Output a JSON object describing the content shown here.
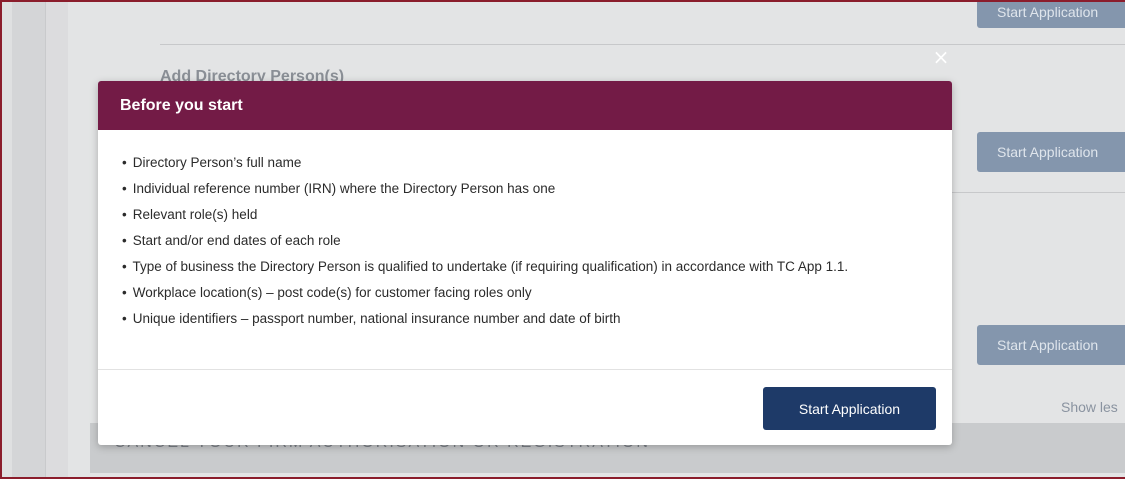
{
  "background": {
    "section_title": "Add Directory Person(s)",
    "start_button_label": "Start Application",
    "show_less": "Show les",
    "cancel_heading": "CANCEL YOUR FIRM AUTHORISATION OR REGISTRATION"
  },
  "modal": {
    "close_glyph": "×",
    "title": "Before you start",
    "bullet": "•",
    "items": [
      "Directory Person’s full name",
      "Individual reference number (IRN) where the Directory Person has one",
      "Relevant role(s) held",
      "Start and/or end dates of each role",
      "Type of business the Directory Person is qualified to undertake (if requiring qualification) in accordance with TC App 1.1.",
      "Workplace location(s) – post code(s) for customer facing roles only",
      "Unique identifiers – passport number, national insurance number and date of birth"
    ],
    "start_button_label": "Start Application"
  },
  "colors": {
    "modal_header": "#731b46",
    "primary_button": "#1e3a68",
    "frame_border": "#8b1d2c"
  }
}
